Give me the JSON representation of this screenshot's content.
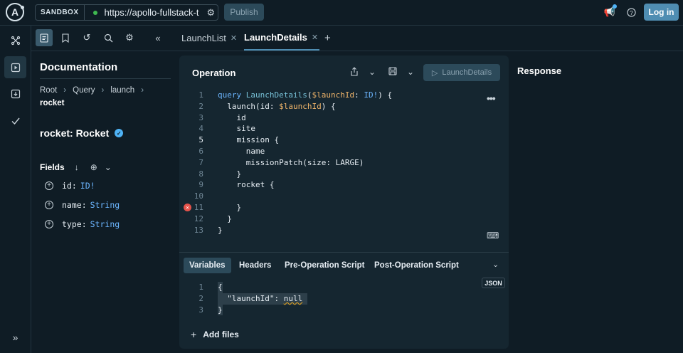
{
  "topbar": {
    "sandbox_label": "SANDBOX",
    "url": "https://apollo-fullstack-t",
    "publish_label": "Publish",
    "login_label": "Log in",
    "logo_letter": "A"
  },
  "tabs": [
    {
      "label": "LaunchList",
      "active": false
    },
    {
      "label": "LaunchDetails",
      "active": true
    }
  ],
  "docs": {
    "title": "Documentation",
    "breadcrumbs": [
      "Root",
      "Query",
      "launch"
    ],
    "current": "rocket",
    "type_heading": "rocket: Rocket",
    "fields_label": "Fields",
    "fields": [
      {
        "name": "id:",
        "type": "ID!"
      },
      {
        "name": "name:",
        "type": "String"
      },
      {
        "name": "type:",
        "type": "String"
      }
    ]
  },
  "operation": {
    "title": "Operation",
    "run_label": "LaunchDetails",
    "error_line": 11,
    "lines": [
      {
        "n": "1",
        "indent": "",
        "parts": [
          [
            "kw",
            "query "
          ],
          [
            "fn",
            "LaunchDetails"
          ],
          [
            "",
            "("
          ],
          [
            "var",
            "$launchId"
          ],
          [
            "",
            ": "
          ],
          [
            "ty",
            "ID!"
          ],
          [
            "",
            ") {"
          ]
        ]
      },
      {
        "n": "2",
        "indent": "  ",
        "parts": [
          [
            "",
            "launch(id: "
          ],
          [
            "var",
            "$launchId"
          ],
          [
            "",
            ") {"
          ]
        ]
      },
      {
        "n": "3",
        "indent": "    ",
        "parts": [
          [
            "",
            "id"
          ]
        ]
      },
      {
        "n": "4",
        "indent": "    ",
        "parts": [
          [
            "",
            "site"
          ]
        ]
      },
      {
        "n": "5",
        "indent": "    ",
        "parts": [
          [
            "",
            "mission {"
          ]
        ]
      },
      {
        "n": "6",
        "indent": "      ",
        "parts": [
          [
            "",
            "name"
          ]
        ]
      },
      {
        "n": "7",
        "indent": "      ",
        "parts": [
          [
            "",
            "missionPatch(size: LARGE)"
          ]
        ]
      },
      {
        "n": "8",
        "indent": "    ",
        "parts": [
          [
            "",
            "}"
          ]
        ]
      },
      {
        "n": "9",
        "indent": "    ",
        "parts": [
          [
            "",
            "rocket {"
          ]
        ]
      },
      {
        "n": "10",
        "indent": "",
        "parts": []
      },
      {
        "n": "11",
        "indent": "    ",
        "parts": [
          [
            "",
            "}"
          ]
        ]
      },
      {
        "n": "12",
        "indent": "  ",
        "parts": [
          [
            "",
            "}"
          ]
        ]
      },
      {
        "n": "13",
        "indent": "",
        "parts": [
          [
            "",
            "}"
          ]
        ]
      }
    ]
  },
  "variables": {
    "tabs": [
      "Variables",
      "Headers",
      "Pre-Operation Script",
      "Post-Operation Script"
    ],
    "format_badge": "JSON",
    "lines": [
      {
        "n": "1",
        "text": "{"
      },
      {
        "n": "2",
        "text": "  \"launchId\": null"
      },
      {
        "n": "3",
        "text": "}"
      }
    ],
    "add_files_label": "Add files"
  },
  "response": {
    "title": "Response"
  }
}
